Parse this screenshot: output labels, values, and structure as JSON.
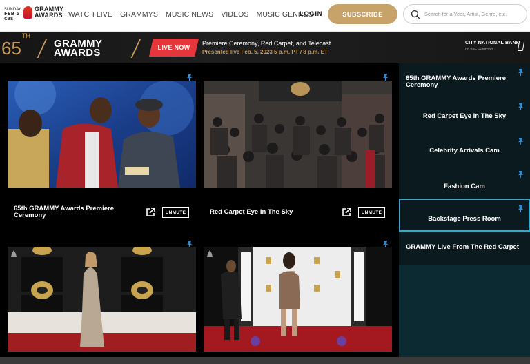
{
  "nav": {
    "badge": [
      "SUNDAY",
      "FEB 5",
      "CBS"
    ],
    "logo_lines": [
      "GRAMMY",
      "AWARDS"
    ],
    "links": [
      "WATCH LIVE",
      "GRAMMYS",
      "MUSIC NEWS",
      "VIDEOS",
      "MUSIC GENRES"
    ],
    "login_label": "LOGIN",
    "subscribe_label": "SUBSCRIBE",
    "search_placeholder": "Search for a Year, Artist, Genre, etc."
  },
  "banner": {
    "edition_number": "65",
    "edition_suffix": "TH",
    "title_lines": [
      "GRAMMY",
      "AWARDS"
    ],
    "live_label": "LIVE NOW",
    "event_title": "Premiere Ceremony, Red Carpet, and Telecast",
    "event_subtitle": "Presented live Feb. 5, 2023 5 p.m. PT / 8 p.m. ET",
    "sponsor_name": "CITY NATIONAL BANK",
    "sponsor_tagline": "AN RBC COMPANY"
  },
  "streams": [
    {
      "caption": "65th GRAMMY Awards Premiere Ceremony",
      "unmute_label": "UNMUTE"
    },
    {
      "caption": "Red Carpet Eye In The Sky",
      "unmute_label": "UNMUTE"
    },
    {
      "caption": "",
      "unmute_label": ""
    },
    {
      "caption": "",
      "unmute_label": ""
    }
  ],
  "sidebar": {
    "items": [
      {
        "label": "65th GRAMMY Awards Premiere Ceremony",
        "active": false
      },
      {
        "label": "Red Carpet Eye In The Sky",
        "active": false
      },
      {
        "label": "Celebrity Arrivals Cam",
        "active": false
      },
      {
        "label": "Fashion Cam",
        "active": false
      },
      {
        "label": "Backstage Press Room",
        "active": true
      },
      {
        "label": "GRAMMY Live From The Red Carpet",
        "active": false
      }
    ]
  },
  "colors": {
    "gold": "#c79b5b",
    "live_red": "#e5373b",
    "subscribe_gold": "#c7a36a",
    "active_border": "#3aa6c5",
    "sidebar_bg": "#0c2a31"
  }
}
